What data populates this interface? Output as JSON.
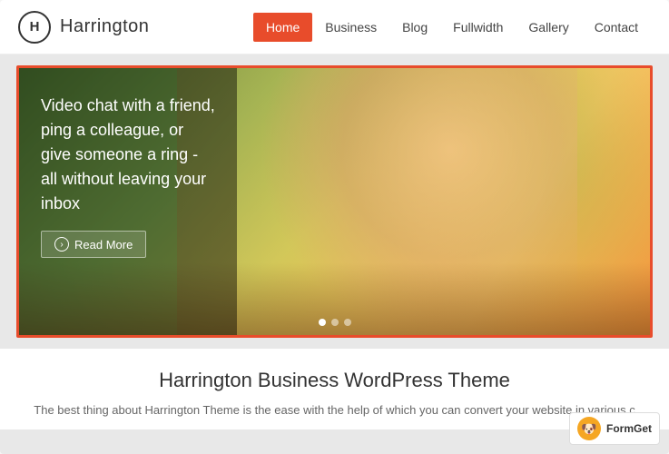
{
  "header": {
    "logo": {
      "letter": "H",
      "name": "Harrington"
    },
    "nav": {
      "items": [
        {
          "label": "Home",
          "active": true
        },
        {
          "label": "Business",
          "active": false
        },
        {
          "label": "Blog",
          "active": false
        },
        {
          "label": "Fullwidth",
          "active": false
        },
        {
          "label": "Gallery",
          "active": false
        },
        {
          "label": "Contact",
          "active": false
        }
      ]
    }
  },
  "hero": {
    "title": "Video chat with a friend, ping a colleague, or give someone a ring - all without leaving your inbox",
    "read_more_label": "Read More"
  },
  "main": {
    "section_title": "Harrington Business WordPress Theme",
    "section_desc": "The best thing about Harrington Theme is the ease with the help of which you can convert your website in various c"
  },
  "formget": {
    "label": "FormGet",
    "icon": "🐶"
  },
  "colors": {
    "accent": "#e84c2b",
    "text_dark": "#333333",
    "text_muted": "#666666"
  }
}
